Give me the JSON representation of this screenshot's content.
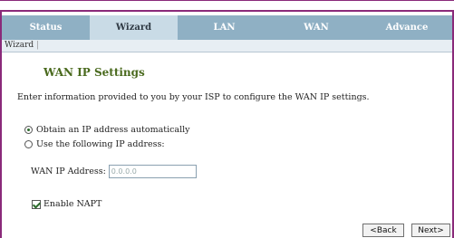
{
  "nav": {
    "tabs": [
      {
        "label": "Status",
        "active": false
      },
      {
        "label": "Wizard",
        "active": true
      },
      {
        "label": "LAN",
        "active": false
      },
      {
        "label": "WAN",
        "active": false
      },
      {
        "label": "Advance",
        "active": false
      }
    ]
  },
  "subnav": {
    "item": "Wizard",
    "separator": "|"
  },
  "page": {
    "title": "WAN IP Settings",
    "description": "Enter information provided to you by your ISP to configure the WAN IP settings."
  },
  "options": {
    "auto_label": "Obtain an IP address automatically",
    "auto_selected": true,
    "manual_label": "Use the following IP address:",
    "manual_selected": false
  },
  "wan_ip": {
    "label": "WAN IP Address:",
    "value": "0.0.0.0"
  },
  "napt": {
    "label": "Enable NAPT",
    "checked": true
  },
  "buttons": {
    "back": "<Back",
    "next": "Next>"
  },
  "colors": {
    "tab_bar": "#8fb0c4",
    "tab_active": "#c9dbe6",
    "title": "#4a6a1e",
    "frame": "#8a2a7a"
  }
}
